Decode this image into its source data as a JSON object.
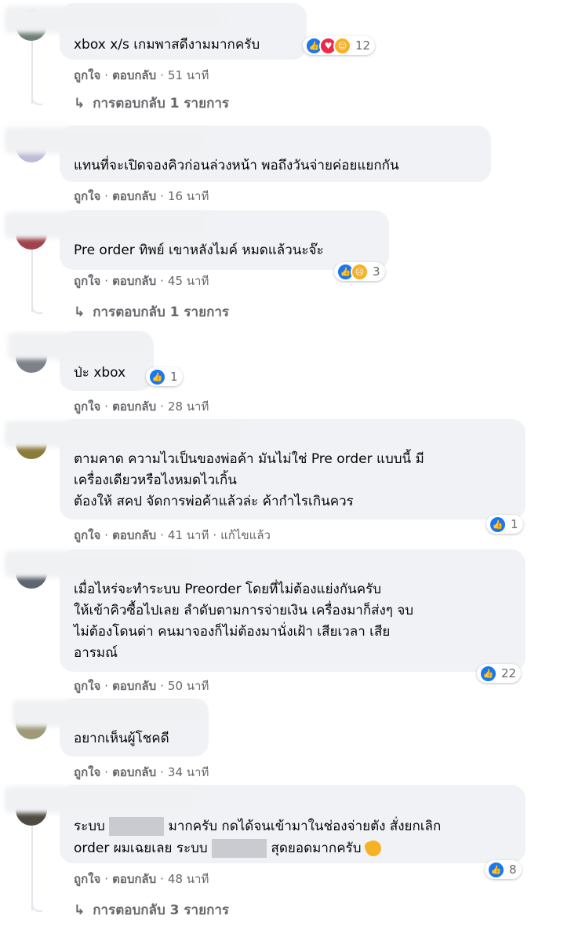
{
  "comments": [
    {
      "text_lines": [
        "xbox x/s เกมพาสดีงามมากครับ"
      ],
      "reactions": [
        "like",
        "love",
        "care"
      ],
      "reaction_count": "12",
      "like_label": "ถูกใจ",
      "reply_label": "ตอบกลับ",
      "time": "51 นาที",
      "replies_text": "การตอบกลับ 1 รายการ"
    },
    {
      "text_lines": [
        "แทนที่จะเปิดจองคิวก่อนล่วงหน้า พอถึงวันจ่ายค่อยแยกกัน"
      ],
      "like_label": "ถูกใจ",
      "reply_label": "ตอบกลับ",
      "time": "16 นาที"
    },
    {
      "text_lines": [
        "Pre order ทิพย์ เขาหลังไมค์ หมดแล้วนะจ๊ะ"
      ],
      "reactions": [
        "like",
        "sad"
      ],
      "reaction_count": "3",
      "like_label": "ถูกใจ",
      "reply_label": "ตอบกลับ",
      "time": "45 นาที",
      "replies_text": "การตอบกลับ 1 รายการ"
    },
    {
      "text_lines": [
        "ป่ะ xbox"
      ],
      "reactions": [
        "like"
      ],
      "reaction_count": "1",
      "like_label": "ถูกใจ",
      "reply_label": "ตอบกลับ",
      "time": "28 นาที"
    },
    {
      "text_lines": [
        "ตามคาด ความไวเป็นของพ่อค้า มันไม่ใช่ Pre order แบบนี้ มี",
        "เครื่องเดียวหรือไงหมดไวเกิ้น",
        "ต้องให้ สคป จัดการพ่อค้าแล้วล่ะ ค้ากำไรเกินควร"
      ],
      "reactions": [
        "like"
      ],
      "reaction_count": "1",
      "like_label": "ถูกใจ",
      "reply_label": "ตอบกลับ",
      "time": "41 นาที",
      "edited": "แก้ไขแล้ว"
    },
    {
      "text_lines": [
        "เมื่อไหร่จะทำระบบ Preorder โดยที่ไม่ต้องแย่งกันครับ",
        "ให้เข้าคิวซื้อไปเลย ลำดับตามการจ่ายเงิน เครื่องมาก็ส่งๆ จบ",
        "ไม่ต้องโดนด่า คนมาจองก็ไม่ต้องมานั่งเฝ้า เสียเวลา เสีย",
        "อารมณ์"
      ],
      "reactions": [
        "like"
      ],
      "reaction_count": "22",
      "like_label": "ถูกใจ",
      "reply_label": "ตอบกลับ",
      "time": "50 นาที"
    },
    {
      "text_lines": [
        "อยากเห็นผู้โชคดี"
      ],
      "like_label": "ถูกใจ",
      "reply_label": "ตอบกลับ",
      "time": "34 นาที"
    },
    {
      "text_parts": {
        "a": "ระบบ",
        "b": "มากครับ กดได้จนเข้ามาในช่องจ่ายตัง สั่งยกเลิก",
        "c": "order ผมเฉยเลย ระบบ",
        "d": "สุดยอดมากครับ"
      },
      "reactions": [
        "like"
      ],
      "reaction_count": "8",
      "like_label": "ถูกใจ",
      "reply_label": "ตอบกลับ",
      "time": "48 นาที",
      "replies_text": "การตอบกลับ 3 รายการ"
    }
  ],
  "icons": {
    "like": "thumbs-up-icon",
    "love": "heart-icon",
    "care": "care-icon",
    "sad": "sad-icon",
    "reply_arrow": "reply-arrow-icon",
    "hand": "ok-hand-icon"
  },
  "colors": {
    "bubble": "#f0f2f5",
    "meta": "#65676b",
    "like": "#1877f2",
    "love": "#f02849",
    "care": "#f7b125"
  }
}
